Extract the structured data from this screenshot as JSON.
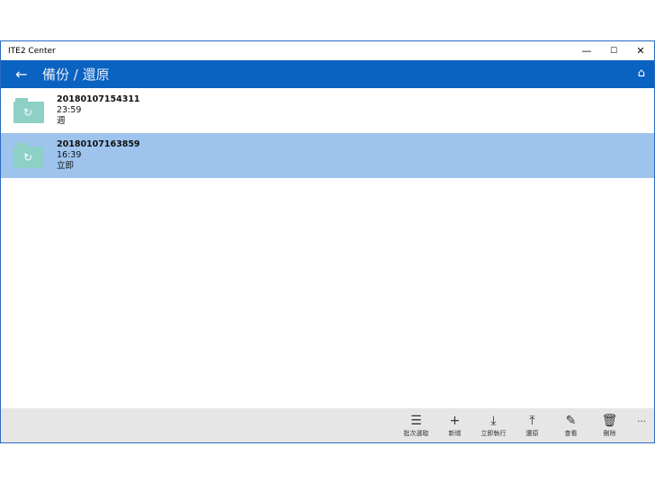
{
  "window": {
    "title": "ITE2 Center",
    "minimize": "—",
    "maximize": "☐",
    "close": "✕"
  },
  "header": {
    "title": "備份 / 還原",
    "back_icon": "←",
    "home_icon": "⌂"
  },
  "items": [
    {
      "name": "20180107154311",
      "time": "23:59",
      "schedule": "週",
      "selected": false
    },
    {
      "name": "20180107163859",
      "time": "16:39",
      "schedule": "立即",
      "selected": true
    }
  ],
  "commands": [
    {
      "label": "批次選取",
      "icon": "☰"
    },
    {
      "label": "新增",
      "icon": "+"
    },
    {
      "label": "立即執行",
      "icon": "⤓"
    },
    {
      "label": "還原",
      "icon": "⤒"
    },
    {
      "label": "查看",
      "icon": "✎"
    },
    {
      "label": "刪除",
      "icon": "🗑"
    }
  ],
  "more": "···"
}
